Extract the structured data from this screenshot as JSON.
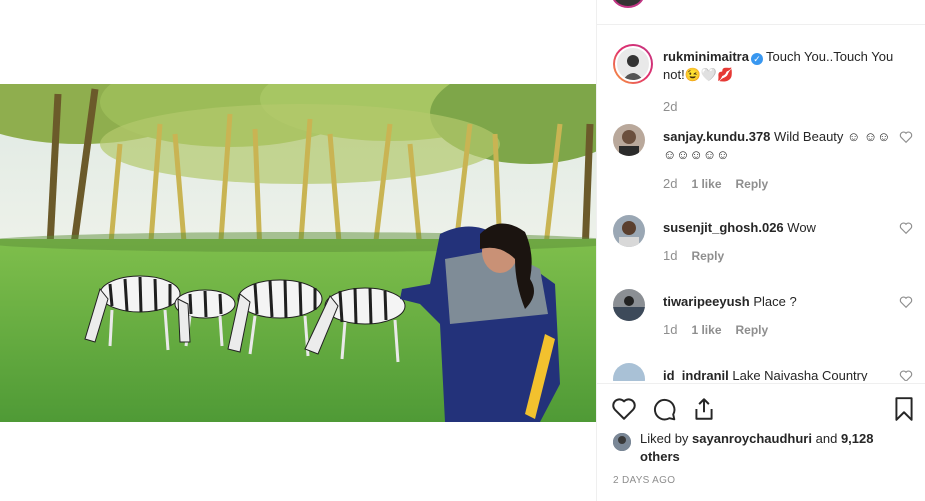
{
  "post": {
    "author": "rukminimaitra",
    "caption": "Touch You..Touch You not!😉🤍💋",
    "caption_age": "2d"
  },
  "comments": [
    {
      "user": "sanjay.kundu.378",
      "text": "Wild Beauty ☺ ☺☺☺☺☺☺☺",
      "age": "2d",
      "likes": "1 like",
      "reply": "Reply"
    },
    {
      "user": "susenjit_ghosh.026",
      "text": "Wow",
      "age": "1d",
      "reply": "Reply"
    },
    {
      "user": "tiwaripeeyush",
      "text": "Place ?",
      "age": "1d",
      "likes": "1 like",
      "reply": "Reply"
    },
    {
      "user": "id_indranil",
      "text": "Lake Naivasha Country"
    }
  ],
  "likes": {
    "prefix": "Liked by",
    "user": "sayanroychaudhuri",
    "and": "and",
    "others": "9,128 others"
  },
  "posted_ago": "2 DAYS AGO",
  "icons": {
    "like": "heart-icon",
    "comment": "comment-icon",
    "share": "share-icon",
    "save": "bookmark-icon",
    "verified": "verified-badge-icon"
  },
  "colors": {
    "text": "#262626",
    "muted": "#8e8e8e",
    "verified": "#3897f0",
    "divider": "#efefef"
  }
}
